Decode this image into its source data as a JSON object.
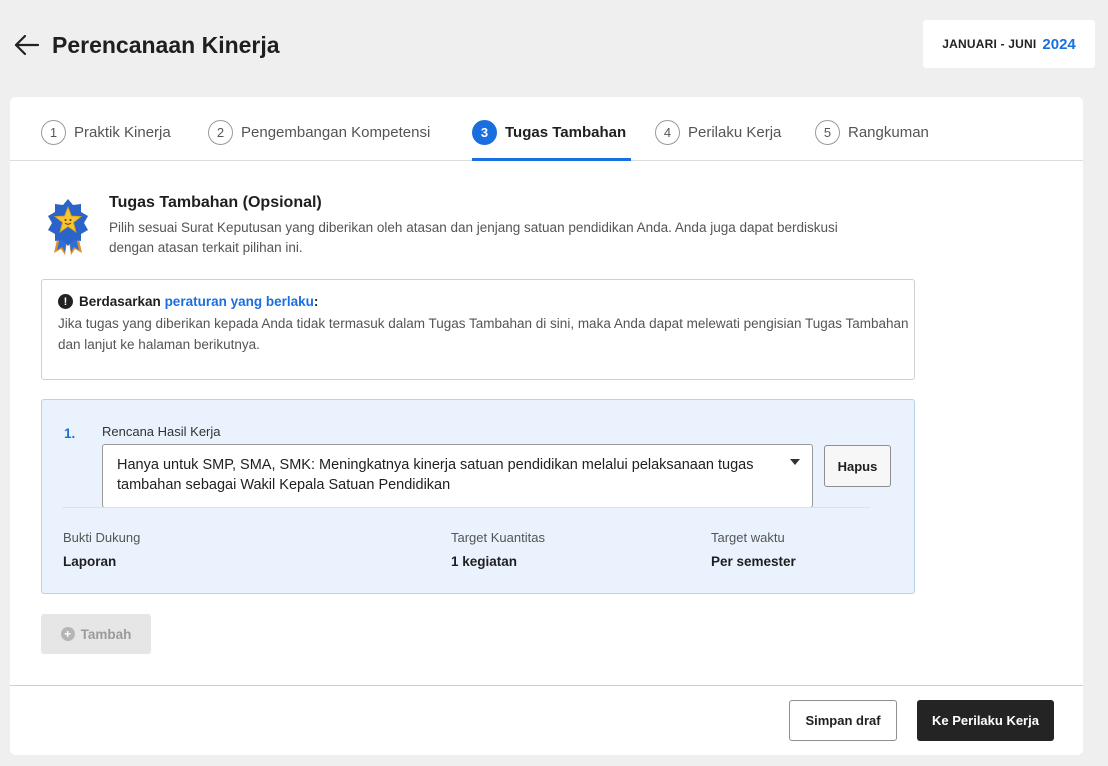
{
  "header": {
    "title": "Perencanaan Kinerja",
    "period_label": "JANUARI - JUNI",
    "period_year": "2024"
  },
  "stepper": {
    "active_step": 3,
    "steps": [
      {
        "num": "1",
        "label": "Praktik Kinerja"
      },
      {
        "num": "2",
        "label": "Pengembangan Kompetensi"
      },
      {
        "num": "3",
        "label": "Tugas Tambahan"
      },
      {
        "num": "4",
        "label": "Perilaku Kerja"
      },
      {
        "num": "5",
        "label": "Rangkuman"
      }
    ]
  },
  "intro": {
    "title": "Tugas Tambahan (Opsional)",
    "description": "Pilih sesuai Surat Keputusan yang diberikan oleh atasan dan jenjang satuan pendidikan Anda. Anda juga dapat berdiskusi dengan atasan terkait pilihan ini."
  },
  "notice": {
    "prefix": "Berdasarkan ",
    "link": "peraturan yang berlaku",
    "suffix": ":",
    "body": "Jika tugas yang diberikan kepada Anda tidak termasuk dalam Tugas Tambahan di sini, maka Anda dapat melewati pengisian Tugas Tambahan dan lanjut ke halaman berikutnya."
  },
  "rhk": {
    "number": "1.",
    "label": "Rencana Hasil Kerja",
    "selected_value": "Hanya untuk SMP, SMA, SMK: Meningkatnya kinerja satuan pendidikan melalui pelaksanaan tugas tambahan sebagai Wakil Kepala Satuan Pendidikan",
    "delete_label": "Hapus",
    "evidence_label": "Bukti Dukung",
    "evidence_value": "Laporan",
    "quantity_label": "Target Kuantitas",
    "quantity_value": "1 kegiatan",
    "time_label": "Target waktu",
    "time_value": "Per semester"
  },
  "add_label": "Tambah",
  "footer": {
    "draft_label": "Simpan draf",
    "next_label": "Ke Perilaku Kerja"
  },
  "colors": {
    "accent": "#1a6fe0",
    "panel_bg": "#eaf3fd",
    "primary_button": "#242424"
  },
  "icons": {
    "back": "arrow-left-icon",
    "medal": "star-medal-icon",
    "notice": "exclamation-circle-icon",
    "dropdown": "caret-down-icon",
    "add": "plus-circle-icon"
  }
}
